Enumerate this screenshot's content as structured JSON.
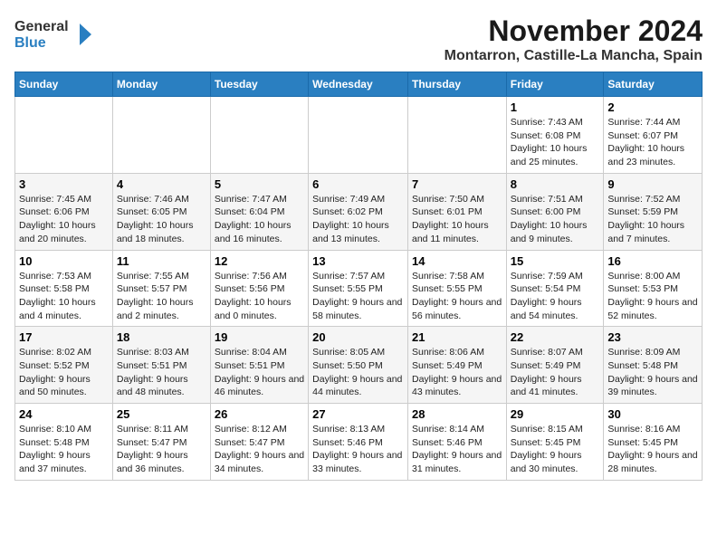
{
  "logo": {
    "line1": "General",
    "line2": "Blue"
  },
  "title": "November 2024",
  "location": "Montarron, Castille-La Mancha, Spain",
  "weekdays": [
    "Sunday",
    "Monday",
    "Tuesday",
    "Wednesday",
    "Thursday",
    "Friday",
    "Saturday"
  ],
  "weeks": [
    [
      {
        "day": "",
        "info": ""
      },
      {
        "day": "",
        "info": ""
      },
      {
        "day": "",
        "info": ""
      },
      {
        "day": "",
        "info": ""
      },
      {
        "day": "",
        "info": ""
      },
      {
        "day": "1",
        "info": "Sunrise: 7:43 AM\nSunset: 6:08 PM\nDaylight: 10 hours and 25 minutes."
      },
      {
        "day": "2",
        "info": "Sunrise: 7:44 AM\nSunset: 6:07 PM\nDaylight: 10 hours and 23 minutes."
      }
    ],
    [
      {
        "day": "3",
        "info": "Sunrise: 7:45 AM\nSunset: 6:06 PM\nDaylight: 10 hours and 20 minutes."
      },
      {
        "day": "4",
        "info": "Sunrise: 7:46 AM\nSunset: 6:05 PM\nDaylight: 10 hours and 18 minutes."
      },
      {
        "day": "5",
        "info": "Sunrise: 7:47 AM\nSunset: 6:04 PM\nDaylight: 10 hours and 16 minutes."
      },
      {
        "day": "6",
        "info": "Sunrise: 7:49 AM\nSunset: 6:02 PM\nDaylight: 10 hours and 13 minutes."
      },
      {
        "day": "7",
        "info": "Sunrise: 7:50 AM\nSunset: 6:01 PM\nDaylight: 10 hours and 11 minutes."
      },
      {
        "day": "8",
        "info": "Sunrise: 7:51 AM\nSunset: 6:00 PM\nDaylight: 10 hours and 9 minutes."
      },
      {
        "day": "9",
        "info": "Sunrise: 7:52 AM\nSunset: 5:59 PM\nDaylight: 10 hours and 7 minutes."
      }
    ],
    [
      {
        "day": "10",
        "info": "Sunrise: 7:53 AM\nSunset: 5:58 PM\nDaylight: 10 hours and 4 minutes."
      },
      {
        "day": "11",
        "info": "Sunrise: 7:55 AM\nSunset: 5:57 PM\nDaylight: 10 hours and 2 minutes."
      },
      {
        "day": "12",
        "info": "Sunrise: 7:56 AM\nSunset: 5:56 PM\nDaylight: 10 hours and 0 minutes."
      },
      {
        "day": "13",
        "info": "Sunrise: 7:57 AM\nSunset: 5:55 PM\nDaylight: 9 hours and 58 minutes."
      },
      {
        "day": "14",
        "info": "Sunrise: 7:58 AM\nSunset: 5:55 PM\nDaylight: 9 hours and 56 minutes."
      },
      {
        "day": "15",
        "info": "Sunrise: 7:59 AM\nSunset: 5:54 PM\nDaylight: 9 hours and 54 minutes."
      },
      {
        "day": "16",
        "info": "Sunrise: 8:00 AM\nSunset: 5:53 PM\nDaylight: 9 hours and 52 minutes."
      }
    ],
    [
      {
        "day": "17",
        "info": "Sunrise: 8:02 AM\nSunset: 5:52 PM\nDaylight: 9 hours and 50 minutes."
      },
      {
        "day": "18",
        "info": "Sunrise: 8:03 AM\nSunset: 5:51 PM\nDaylight: 9 hours and 48 minutes."
      },
      {
        "day": "19",
        "info": "Sunrise: 8:04 AM\nSunset: 5:51 PM\nDaylight: 9 hours and 46 minutes."
      },
      {
        "day": "20",
        "info": "Sunrise: 8:05 AM\nSunset: 5:50 PM\nDaylight: 9 hours and 44 minutes."
      },
      {
        "day": "21",
        "info": "Sunrise: 8:06 AM\nSunset: 5:49 PM\nDaylight: 9 hours and 43 minutes."
      },
      {
        "day": "22",
        "info": "Sunrise: 8:07 AM\nSunset: 5:49 PM\nDaylight: 9 hours and 41 minutes."
      },
      {
        "day": "23",
        "info": "Sunrise: 8:09 AM\nSunset: 5:48 PM\nDaylight: 9 hours and 39 minutes."
      }
    ],
    [
      {
        "day": "24",
        "info": "Sunrise: 8:10 AM\nSunset: 5:48 PM\nDaylight: 9 hours and 37 minutes."
      },
      {
        "day": "25",
        "info": "Sunrise: 8:11 AM\nSunset: 5:47 PM\nDaylight: 9 hours and 36 minutes."
      },
      {
        "day": "26",
        "info": "Sunrise: 8:12 AM\nSunset: 5:47 PM\nDaylight: 9 hours and 34 minutes."
      },
      {
        "day": "27",
        "info": "Sunrise: 8:13 AM\nSunset: 5:46 PM\nDaylight: 9 hours and 33 minutes."
      },
      {
        "day": "28",
        "info": "Sunrise: 8:14 AM\nSunset: 5:46 PM\nDaylight: 9 hours and 31 minutes."
      },
      {
        "day": "29",
        "info": "Sunrise: 8:15 AM\nSunset: 5:45 PM\nDaylight: 9 hours and 30 minutes."
      },
      {
        "day": "30",
        "info": "Sunrise: 8:16 AM\nSunset: 5:45 PM\nDaylight: 9 hours and 28 minutes."
      }
    ]
  ]
}
